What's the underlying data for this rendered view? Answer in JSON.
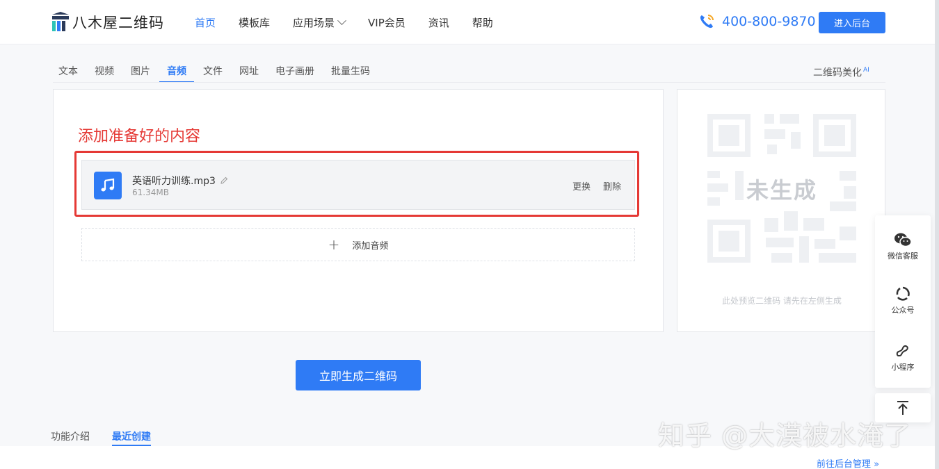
{
  "header": {
    "logo_text": "八木屋二维码",
    "nav": [
      {
        "label": "首页",
        "active": true
      },
      {
        "label": "模板库"
      },
      {
        "label": "应用场景",
        "dropdown": true
      },
      {
        "label": "VIP会员"
      },
      {
        "label": "资讯"
      },
      {
        "label": "帮助"
      }
    ],
    "phone": "400-800-9870",
    "enter_button": "进入后台"
  },
  "type_tabs": [
    {
      "label": "文本"
    },
    {
      "label": "视频"
    },
    {
      "label": "图片"
    },
    {
      "label": "音频",
      "active": true
    },
    {
      "label": "文件"
    },
    {
      "label": "网址"
    },
    {
      "label": "电子画册"
    },
    {
      "label": "批量生码"
    }
  ],
  "beautify": {
    "label": "二维码美化",
    "badge": "AI"
  },
  "annotation": "添加准备好的内容",
  "file": {
    "name": "英语听力训练.mp3",
    "size": "61.34MB",
    "replace_label": "更换",
    "delete_label": "删除"
  },
  "add_audio_label": "添加音频",
  "preview": {
    "status": "未生成",
    "hint": "此处预览二维码 请先在左侧生成"
  },
  "generate_button": "立即生成二维码",
  "bottom_tabs": [
    {
      "label": "功能介绍"
    },
    {
      "label": "最近创建",
      "active": true
    }
  ],
  "manage_link": "前往后台管理 »",
  "side_float": {
    "wechat_service": "微信客服",
    "official_account": "公众号",
    "mini_program": "小程序"
  },
  "watermark": "知乎 @大漠被水淹了",
  "colors": {
    "accent": "#2f7bf5",
    "annotation": "#e53935"
  }
}
